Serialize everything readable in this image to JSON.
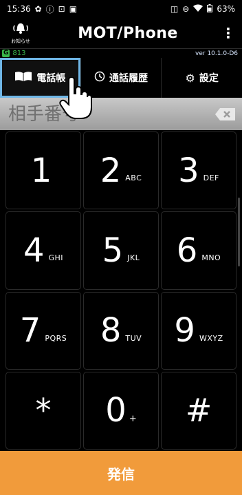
{
  "status_bar": {
    "time": "15:36",
    "battery": "63%",
    "left_icons": [
      "gear-icon",
      "info-icon",
      "tune-icon",
      "image-icon"
    ],
    "right_icons": [
      "vibrate-icon",
      "dnd-icon",
      "wifi-icon",
      "battery-icon"
    ]
  },
  "app_bar": {
    "notice_label": "お知らせ",
    "title": "MOT/Phone",
    "menu": "⋮"
  },
  "sub_bar": {
    "extension": "813",
    "version": "ver 10.1.0-D6"
  },
  "tabs": [
    {
      "label": "電話帳",
      "icon": "book-icon",
      "selected": true
    },
    {
      "label": "通話履歴",
      "icon": "clock-icon",
      "selected": false
    },
    {
      "label": "設定",
      "icon": "gear-icon",
      "selected": false
    }
  ],
  "dial_input": {
    "value": "",
    "placeholder": "相手番号"
  },
  "keypad": [
    {
      "digit": "1",
      "letters": ""
    },
    {
      "digit": "2",
      "letters": "ABC"
    },
    {
      "digit": "3",
      "letters": "DEF"
    },
    {
      "digit": "4",
      "letters": "GHI"
    },
    {
      "digit": "5",
      "letters": "JKL"
    },
    {
      "digit": "6",
      "letters": "MNO"
    },
    {
      "digit": "7",
      "letters": "PQRS"
    },
    {
      "digit": "8",
      "letters": "TUV"
    },
    {
      "digit": "9",
      "letters": "WXYZ"
    },
    {
      "digit": "*",
      "letters": ""
    },
    {
      "digit": "0",
      "letters": "+"
    },
    {
      "digit": "#",
      "letters": ""
    }
  ],
  "call_button": {
    "label": "発信",
    "color": "#f19b3b"
  },
  "colors": {
    "tab_highlight": "#6fb6e6",
    "extension_green": "#39b54a"
  }
}
